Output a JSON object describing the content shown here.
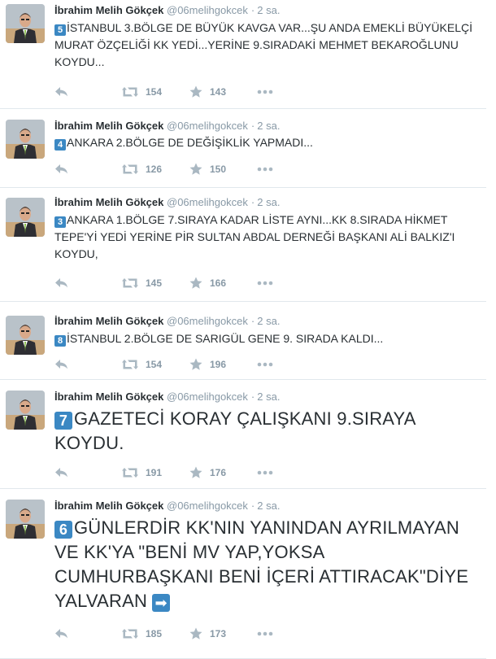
{
  "tweets": [
    {
      "name": "İbrahim Melih Gökçek",
      "handle": "@06melihgokcek",
      "dot": "·",
      "time": "2 sa.",
      "badge": "5",
      "text": "İSTANBUL 3.BÖLGE DE BÜYÜK KAVGA VAR...ŞU ANDA EMEKLİ BÜYÜKELÇİ MURAT ÖZÇELİĞİ KK YEDİ...YERİNE 9.SIRADAKİ MEHMET BEKAROĞLUNU KOYDU...",
      "retweets": "154",
      "favorites": "143"
    },
    {
      "name": "İbrahim Melih Gökçek",
      "handle": "@06melihgokcek",
      "dot": "·",
      "time": "2 sa.",
      "badge": "4",
      "text": "ANKARA 2.BÖLGE DE DEĞİŞİKLİK YAPMADI...",
      "retweets": "126",
      "favorites": "150"
    },
    {
      "name": "İbrahim Melih Gökçek",
      "handle": "@06melihgokcek",
      "dot": "·",
      "time": "2 sa.",
      "badge": "3",
      "text": "ANKARA 1.BÖLGE 7.SIRAYA KADAR LİSTE AYNI...KK 8.SIRADA HİKMET TEPE'Yİ YEDİ YERİNE PİR SULTAN ABDAL DERNEĞİ BAŞKANI ALİ BALKIZ'I KOYDU,",
      "retweets": "145",
      "favorites": "166"
    },
    {
      "name": "İbrahim Melih Gökçek",
      "handle": "@06melihgokcek",
      "dot": "·",
      "time": "2 sa.",
      "badge": "8",
      "text": "İSTANBUL 2.BÖLGE DE SARIGÜL GENE 9. SIRADA KALDI...",
      "retweets": "154",
      "favorites": "196"
    },
    {
      "name": "İbrahim Melih Gökçek",
      "handle": "@06melihgokcek",
      "dot": "·",
      "time": "2 sa.",
      "badge": "7",
      "text": "GAZETECİ KORAY ÇALIŞKANI 9.SIRAYA KOYDU.",
      "retweets": "191",
      "favorites": "176"
    },
    {
      "name": "İbrahim Melih Gökçek",
      "handle": "@06melihgokcek",
      "dot": "·",
      "time": "2 sa.",
      "badge": "6",
      "text": "GÜNLERDİR KK'NIN YANINDAN AYRILMAYAN VE KK'YA \"BENİ MV YAP,YOKSA CUMHURBAŞKANI BENİ İÇERİ ATTIRACAK\"DİYE YALVARAN",
      "arrow": "➡",
      "retweets": "185",
      "favorites": "173"
    }
  ],
  "icons": {
    "reply": "reply-icon",
    "retweet": "retweet-icon",
    "favorite": "star-icon",
    "more": "more-icon"
  },
  "colors": {
    "text": "#292f33",
    "muted": "#8899a6",
    "icon": "#aab8c2",
    "badge": "#3b88c3"
  }
}
